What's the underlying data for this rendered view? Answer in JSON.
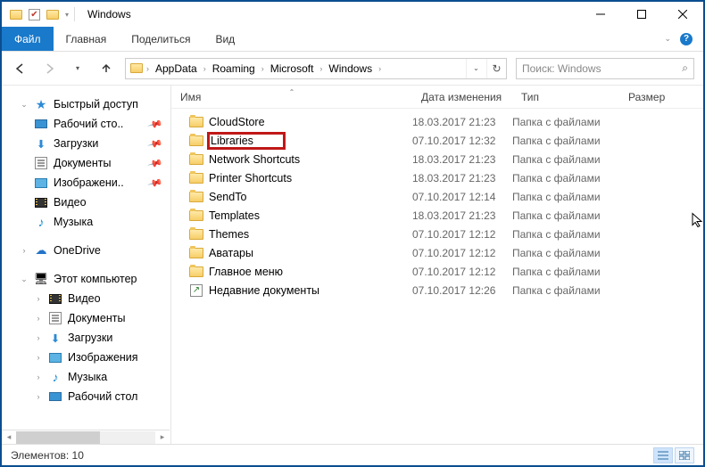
{
  "window": {
    "title": "Windows"
  },
  "ribbon": {
    "file": "Файл",
    "tabs": [
      "Главная",
      "Поделиться",
      "Вид"
    ]
  },
  "breadcrumbs": [
    "AppData",
    "Roaming",
    "Microsoft",
    "Windows"
  ],
  "search": {
    "placeholder": "Поиск: Windows"
  },
  "columns": {
    "name": "Имя",
    "date": "Дата изменения",
    "type": "Тип",
    "size": "Размер"
  },
  "sidebar": {
    "quick": {
      "label": "Быстрый доступ",
      "items": [
        {
          "label": "Рабочий сто..",
          "icon": "desktop",
          "pinned": true
        },
        {
          "label": "Загрузки",
          "icon": "downloads",
          "pinned": true
        },
        {
          "label": "Документы",
          "icon": "docs",
          "pinned": true
        },
        {
          "label": "Изображени..",
          "icon": "pics",
          "pinned": true
        },
        {
          "label": "Видео",
          "icon": "video",
          "pinned": false
        },
        {
          "label": "Музыка",
          "icon": "music",
          "pinned": false
        }
      ]
    },
    "onedrive": {
      "label": "OneDrive"
    },
    "pc": {
      "label": "Этот компьютер",
      "items": [
        {
          "label": "Видео",
          "icon": "video"
        },
        {
          "label": "Документы",
          "icon": "docs"
        },
        {
          "label": "Загрузки",
          "icon": "downloads"
        },
        {
          "label": "Изображения",
          "icon": "pics"
        },
        {
          "label": "Музыка",
          "icon": "music"
        },
        {
          "label": "Рабочий стол",
          "icon": "desktop"
        }
      ]
    }
  },
  "files": [
    {
      "name": "CloudStore",
      "date": "18.03.2017 21:23",
      "type": "Папка с файлами",
      "icon": "folder"
    },
    {
      "name": "Libraries",
      "date": "07.10.2017 12:32",
      "type": "Папка с файлами",
      "icon": "folder",
      "highlight": true
    },
    {
      "name": "Network Shortcuts",
      "date": "18.03.2017 21:23",
      "type": "Папка с файлами",
      "icon": "folder"
    },
    {
      "name": "Printer Shortcuts",
      "date": "18.03.2017 21:23",
      "type": "Папка с файлами",
      "icon": "folder"
    },
    {
      "name": "SendTo",
      "date": "07.10.2017 12:14",
      "type": "Папка с файлами",
      "icon": "folder"
    },
    {
      "name": "Templates",
      "date": "18.03.2017 21:23",
      "type": "Папка с файлами",
      "icon": "folder"
    },
    {
      "name": "Themes",
      "date": "07.10.2017 12:12",
      "type": "Папка с файлами",
      "icon": "folder"
    },
    {
      "name": "Аватары",
      "date": "07.10.2017 12:12",
      "type": "Папка с файлами",
      "icon": "folder"
    },
    {
      "name": "Главное меню",
      "date": "07.10.2017 12:12",
      "type": "Папка с файлами",
      "icon": "folder"
    },
    {
      "name": "Недавние документы",
      "date": "07.10.2017 12:26",
      "type": "Папка с файлами",
      "icon": "shortcut"
    }
  ],
  "status": {
    "text": "Элементов: 10"
  }
}
